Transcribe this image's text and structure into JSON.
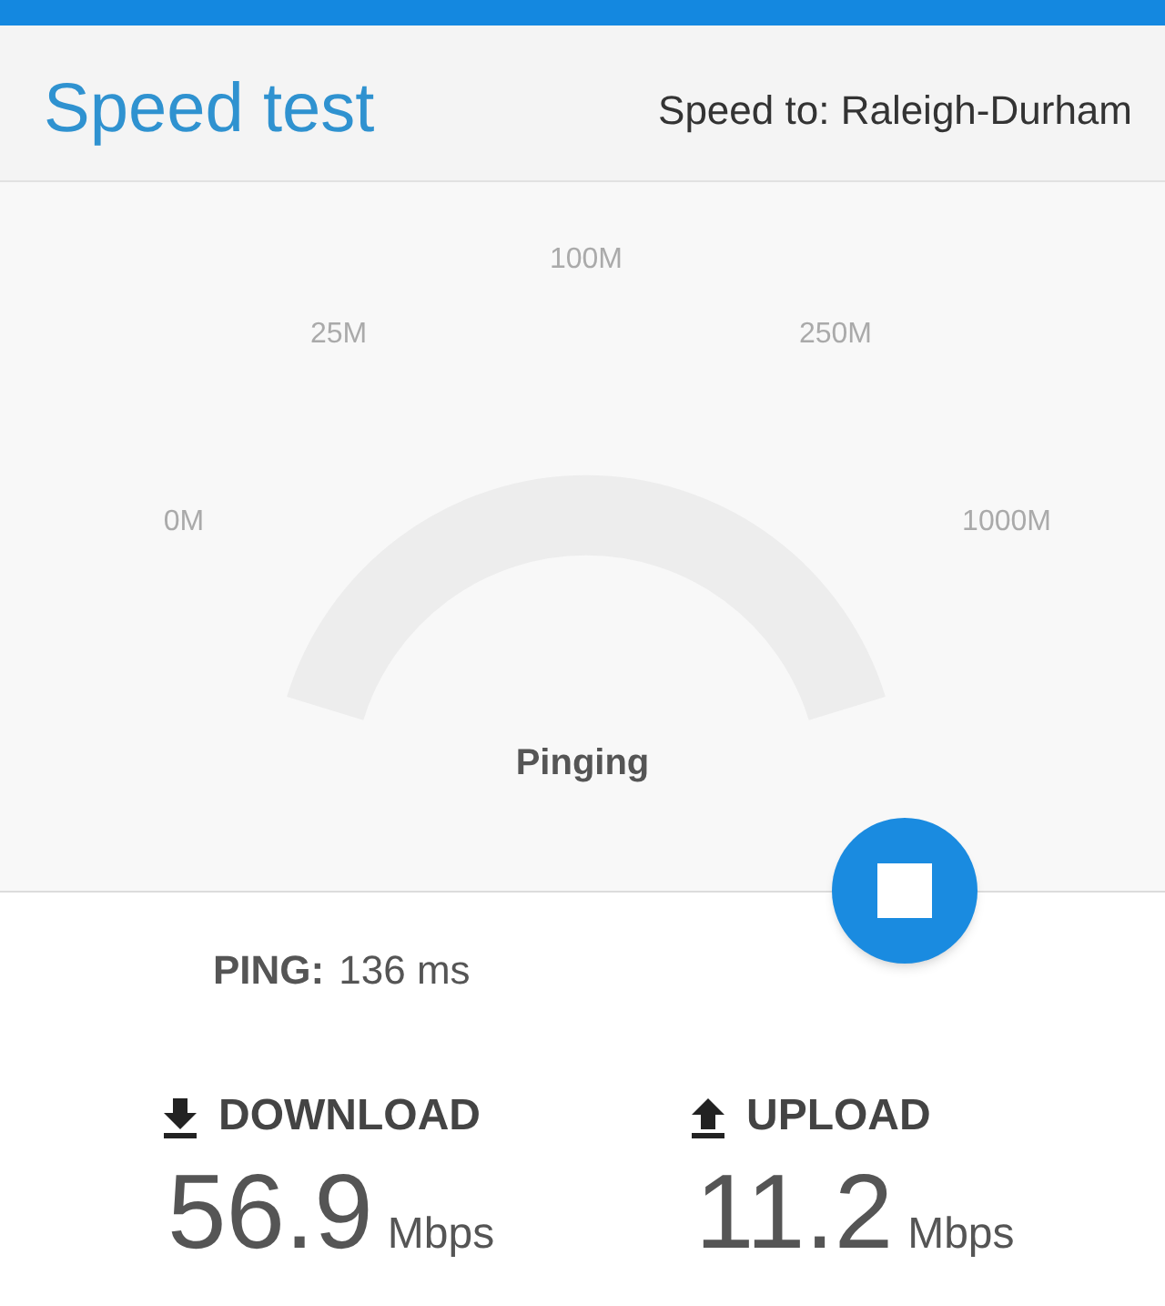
{
  "header": {
    "title": "Speed test",
    "server": "Speed to: Raleigh-Durham"
  },
  "gauge": {
    "ticks": [
      "0M",
      "25M",
      "100M",
      "250M",
      "1000M"
    ],
    "status": "Pinging"
  },
  "ping": {
    "label": "PING:",
    "value": "136 ms"
  },
  "results": [
    {
      "kind": "download",
      "label": "DOWNLOAD",
      "value": "56.9",
      "unit": "Mbps"
    },
    {
      "kind": "upload",
      "label": "UPLOAD",
      "value": "11.2",
      "unit": "Mbps"
    }
  ]
}
